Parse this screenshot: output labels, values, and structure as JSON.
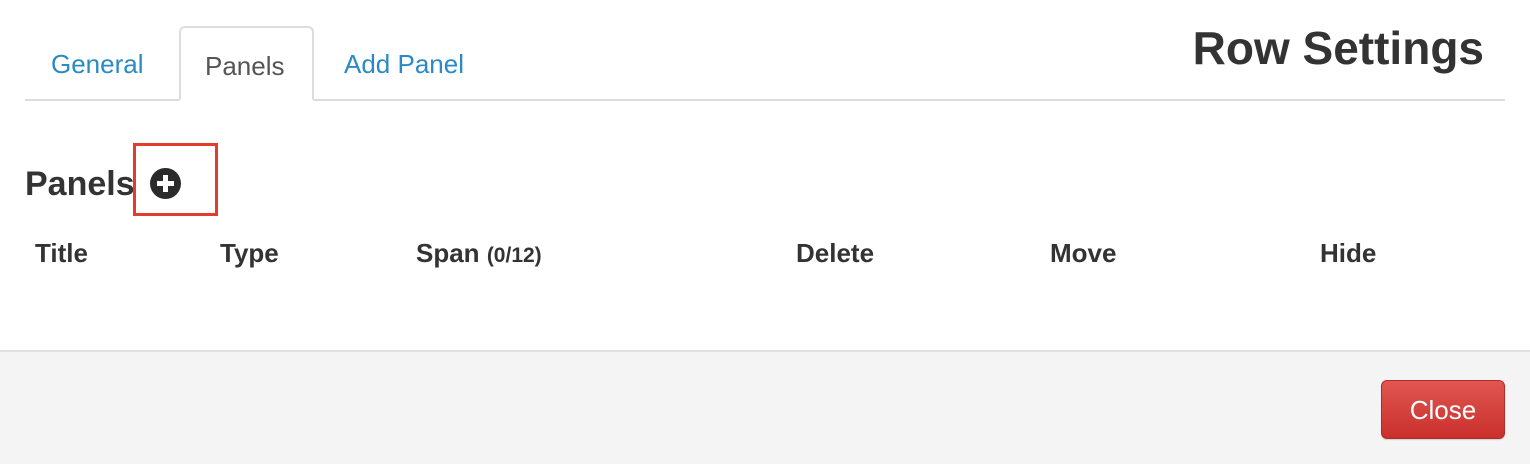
{
  "modal": {
    "title": "Row Settings"
  },
  "tabs": [
    {
      "label": "General",
      "active": false
    },
    {
      "label": "Panels",
      "active": true
    },
    {
      "label": "Add Panel",
      "active": false
    }
  ],
  "panels_section": {
    "heading": "Panels",
    "add_icon": "plus-circle-icon",
    "highlight_color": "#e53a2e"
  },
  "table": {
    "columns": {
      "title": "Title",
      "type": "Type",
      "span": "Span",
      "span_count": "(0/12)",
      "delete": "Delete",
      "move": "Move",
      "hide": "Hide"
    },
    "rows": []
  },
  "footer": {
    "close_label": "Close",
    "close_color": "#d9534f"
  },
  "colors": {
    "link": "#2a8ac6",
    "text": "#333333",
    "footer_bg": "#f4f4f4"
  }
}
